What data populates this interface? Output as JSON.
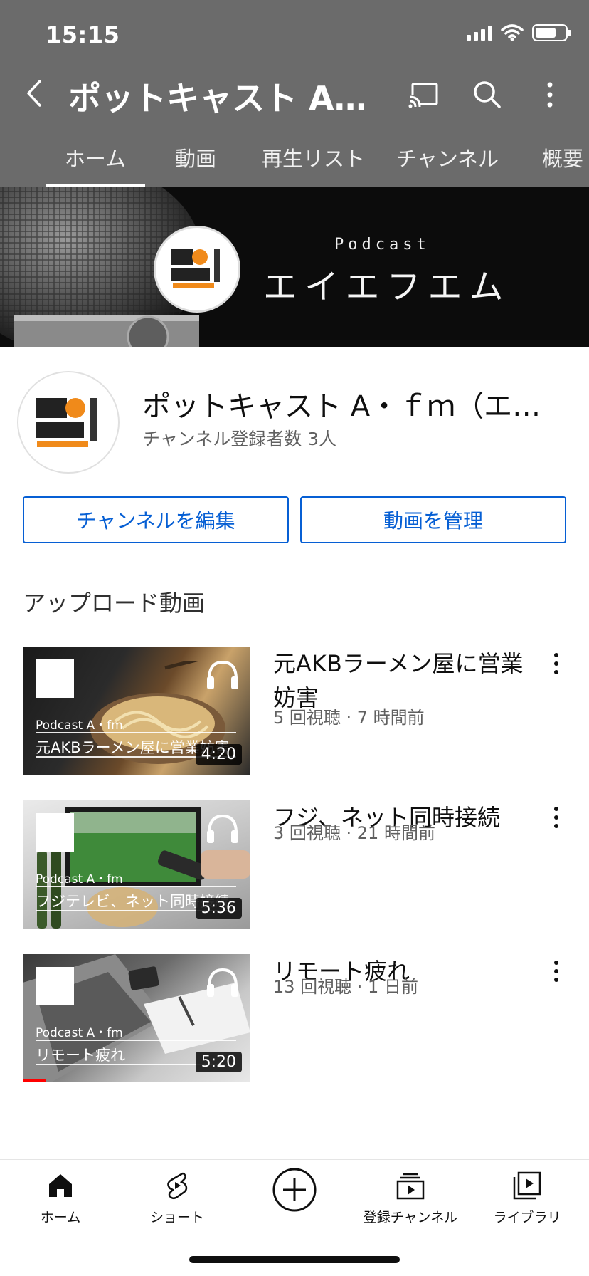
{
  "status_bar": {
    "time": "15:15"
  },
  "header": {
    "title": "ポットキャスト A・f …",
    "icons": [
      "back-icon",
      "cast-icon",
      "search-icon",
      "more-vert-icon"
    ]
  },
  "tabs": [
    {
      "label": "ホーム",
      "active": true
    },
    {
      "label": "動画",
      "active": false
    },
    {
      "label": "再生リスト",
      "active": false
    },
    {
      "label": "チャンネル",
      "active": false
    },
    {
      "label": "概要",
      "active": false
    }
  ],
  "banner": {
    "subtitle": "Podcast",
    "title": "エイエフエム"
  },
  "channel": {
    "name": "ポットキャスト A・ｆｍ（エイ…",
    "subscribers": "チャンネル登録者数 3人"
  },
  "actions": {
    "edit": "チャンネルを編集",
    "manage": "動画を管理"
  },
  "uploads": {
    "title": "アップロード動画",
    "videos": [
      {
        "title": "元AKBラーメン屋に営業妨害",
        "meta": "5 回視聴 · 7 時間前",
        "duration": "4:20",
        "thumb_caption": "Podcast A・fm",
        "thumb_title": "元AKBラーメン屋に営業妨害",
        "progress": 0
      },
      {
        "title": "フジ、ネット同時接続",
        "meta": "3 回視聴 · 21 時間前",
        "duration": "5:36",
        "thumb_caption": "Podcast A・fm",
        "thumb_title": "フジテレビ、ネット同時接続",
        "progress": 0
      },
      {
        "title": "リモート疲れ",
        "meta": "13 回視聴 · 1 日前",
        "duration": "5:20",
        "thumb_caption": "Podcast A・fm",
        "thumb_title": "リモート疲れ",
        "progress": 0.1
      }
    ]
  },
  "bottom_nav": [
    {
      "label": "ホーム",
      "icon": "home-icon"
    },
    {
      "label": "ショート",
      "icon": "shorts-icon"
    },
    {
      "label": "",
      "icon": "create-icon"
    },
    {
      "label": "登録チャンネル",
      "icon": "subscriptions-icon"
    },
    {
      "label": "ライブラリ",
      "icon": "library-icon"
    }
  ],
  "colors": {
    "header_bg": "#6b6b6b",
    "accent_blue": "#065fd4",
    "progress_red": "#ff0000"
  }
}
